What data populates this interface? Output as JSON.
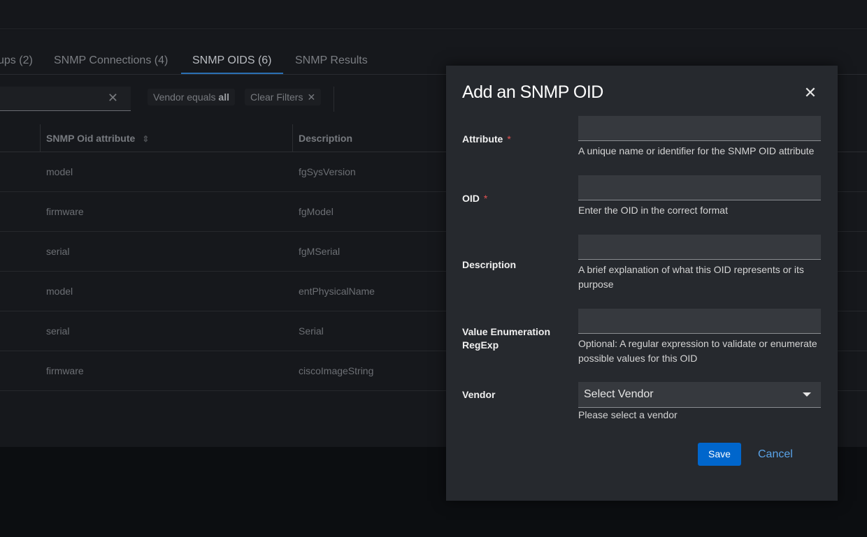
{
  "tabs": [
    {
      "label": "ups (2)"
    },
    {
      "label": "SNMP Connections (4)"
    },
    {
      "label": "SNMP OIDS (6)"
    },
    {
      "label": "SNMP Results"
    }
  ],
  "filters": {
    "search_clear": "✕",
    "vendor_chip_prefix": "Vendor equals ",
    "vendor_chip_value": "all",
    "clear_filters": "Clear Filters",
    "clear_x": "✕"
  },
  "table": {
    "headers": [
      "SNMP Oid attribute",
      "Description"
    ],
    "sort_glyph": "⇕",
    "rows": [
      {
        "attribute": "model",
        "description": "fgSysVersion"
      },
      {
        "attribute": "firmware",
        "description": "fgModel"
      },
      {
        "attribute": "serial",
        "description": "fgMSerial"
      },
      {
        "attribute": "model",
        "description": "entPhysicalName"
      },
      {
        "attribute": "serial",
        "description": "Serial"
      },
      {
        "attribute": "firmware",
        "description": "ciscoImageString"
      }
    ]
  },
  "modal": {
    "title": "Add an SNMP OID",
    "close": "✕",
    "fields": {
      "attribute": {
        "label": "Attribute",
        "required": "*",
        "value": "",
        "helper": "A unique name or identifier for the SNMP OID attribute"
      },
      "oid": {
        "label": "OID",
        "required": "*",
        "value": "",
        "helper": "Enter the OID in the correct format"
      },
      "description": {
        "label": "Description",
        "value": "",
        "helper": "A brief explanation of what this OID represents or its purpose"
      },
      "regexp": {
        "label": "Value Enumeration RegExp",
        "value": "",
        "helper": "Optional: A regular expression to validate or enumerate possible values for this OID"
      },
      "vendor": {
        "label": "Vendor",
        "selected": "Select Vendor",
        "helper": "Please select a vendor"
      }
    },
    "save_label": "Save",
    "cancel_label": "Cancel"
  },
  "colors": {
    "primary": "#0066cc",
    "link": "#5aa3e8",
    "required": "#e05252",
    "modal_bg": "#26292e"
  }
}
